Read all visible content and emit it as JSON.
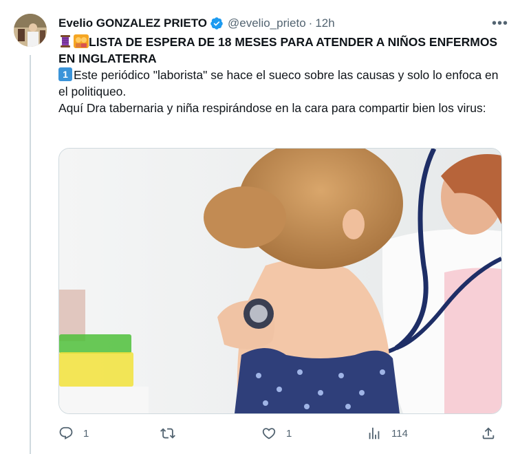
{
  "tweet": {
    "author_name": "Evelio GONZALEZ PRIETO",
    "handle": "@evelio_prieto",
    "separator": "·",
    "time": "12h",
    "more_label": "•••",
    "title": "LISTA DE ESPERA DE 18 MESES PARA ATENDER A NIÑOS ENFERMOS EN INGLATERRA",
    "paragraph1": "Este periódico \"laborista\" se hace el sueco sobre las causas y solo lo enfoca en el politiqueo.",
    "paragraph2": "Aquí Dra tabernaria y niña respirándose en la cara para compartir bien los virus:",
    "title_emojis": [
      "thread-spool-emoji",
      "children-emoji"
    ],
    "paragraph1_emoji": "keycap-one-emoji",
    "image_description_icon": "doctor-child-stethoscope-photo"
  },
  "actions": {
    "reply_count": "1",
    "retweet_count": "",
    "like_count": "1",
    "views_count": "114"
  },
  "colors": {
    "accent": "#1d9bf0",
    "secondary_text": "#536471",
    "border": "#cfd9de"
  }
}
